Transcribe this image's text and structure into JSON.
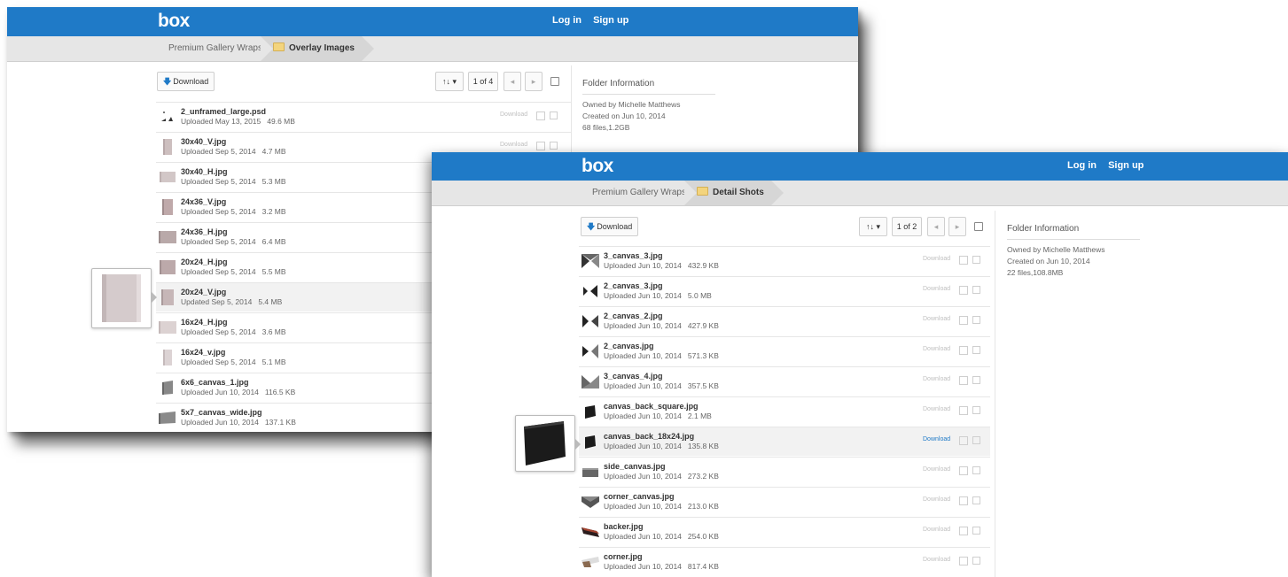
{
  "brand": "box",
  "auth": {
    "login": "Log in",
    "signup": "Sign up"
  },
  "colors": {
    "header": "#1f7ac7",
    "accent": "#1f7ac7"
  },
  "window1": {
    "breadcrumb": {
      "parent": "Premium Gallery Wraps",
      "current": "Overlay Images"
    },
    "toolbar": {
      "download": "Download",
      "sort": "↑↓ ▾",
      "page": "1 of 4",
      "prev": "◂",
      "next": "▸"
    },
    "info": {
      "title": "Folder Information",
      "owner": "Owned by Michelle Matthews",
      "created": "Created on Jun 10, 2014",
      "stats": "68 files,1.2GB"
    },
    "row_download": "Download",
    "files": [
      {
        "name": "2_unframed_large.psd",
        "date": "Uploaded May 13, 2015",
        "size": "49.6 MB"
      },
      {
        "name": "30x40_V.jpg",
        "date": "Uploaded Sep 5, 2014",
        "size": "4.7 MB"
      },
      {
        "name": "30x40_H.jpg",
        "date": "Uploaded Sep 5, 2014",
        "size": "5.3 MB"
      },
      {
        "name": "24x36_V.jpg",
        "date": "Uploaded Sep 5, 2014",
        "size": "3.2 MB"
      },
      {
        "name": "24x36_H.jpg",
        "date": "Uploaded Sep 5, 2014",
        "size": "6.4 MB"
      },
      {
        "name": "20x24_H.jpg",
        "date": "Uploaded Sep 5, 2014",
        "size": "5.5 MB"
      },
      {
        "name": "20x24_V.jpg",
        "date": "Updated Sep 5, 2014",
        "size": "5.4 MB"
      },
      {
        "name": "16x24_H.jpg",
        "date": "Uploaded Sep 5, 2014",
        "size": "3.6 MB"
      },
      {
        "name": "16x24_v.jpg",
        "date": "Uploaded Sep 5, 2014",
        "size": "5.1 MB"
      },
      {
        "name": "6x6_canvas_1.jpg",
        "date": "Uploaded Jun 10, 2014",
        "size": "116.5 KB"
      },
      {
        "name": "5x7_canvas_wide.jpg",
        "date": "Uploaded Jun 10, 2014",
        "size": "137.1 KB"
      }
    ]
  },
  "window2": {
    "breadcrumb": {
      "parent": "Premium Gallery Wraps",
      "current": "Detail Shots"
    },
    "toolbar": {
      "download": "Download",
      "sort": "↑↓ ▾",
      "page": "1 of 2",
      "prev": "◂",
      "next": "▸"
    },
    "info": {
      "title": "Folder Information",
      "owner": "Owned by Michelle Matthews",
      "created": "Created on Jun 10, 2014",
      "stats": "22 files,108.8MB"
    },
    "row_download": "Download",
    "files": [
      {
        "name": "3_canvas_3.jpg",
        "date": "Uploaded Jun 10, 2014",
        "size": "432.9 KB"
      },
      {
        "name": "2_canvas_3.jpg",
        "date": "Uploaded Jun 10, 2014",
        "size": "5.0 MB"
      },
      {
        "name": "2_canvas_2.jpg",
        "date": "Uploaded Jun 10, 2014",
        "size": "427.9 KB"
      },
      {
        "name": "2_canvas.jpg",
        "date": "Uploaded Jun 10, 2014",
        "size": "571.3 KB"
      },
      {
        "name": "3_canvas_4.jpg",
        "date": "Uploaded Jun 10, 2014",
        "size": "357.5 KB"
      },
      {
        "name": "canvas_back_square.jpg",
        "date": "Uploaded Jun 10, 2014",
        "size": "2.1 MB"
      },
      {
        "name": "canvas_back_18x24.jpg",
        "date": "Uploaded Jun 10, 2014",
        "size": "135.8 KB"
      },
      {
        "name": "side_canvas.jpg",
        "date": "Uploaded Jun 10, 2014",
        "size": "273.2 KB"
      },
      {
        "name": "corner_canvas.jpg",
        "date": "Uploaded Jun 10, 2014",
        "size": "213.0 KB"
      },
      {
        "name": "backer.jpg",
        "date": "Uploaded Jun 10, 2014",
        "size": "254.0 KB"
      },
      {
        "name": "corner.jpg",
        "date": "Uploaded Jun 10, 2014",
        "size": "817.4 KB"
      }
    ]
  }
}
